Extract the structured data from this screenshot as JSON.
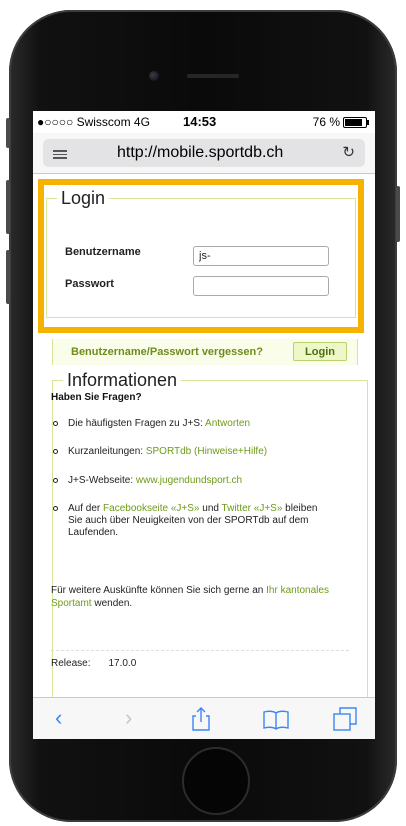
{
  "status": {
    "carrier": "●○○○○ Swisscom  4G",
    "time": "14:53",
    "battery": "76 %"
  },
  "browser": {
    "url": "http://mobile.sportdb.ch"
  },
  "login": {
    "legend": "Login",
    "username_label": "Benutzername",
    "username_value": "js-",
    "password_label": "Passwort",
    "password_value": "",
    "forgot_link": "Benutzername/Passwort vergessen?",
    "login_button": "Login"
  },
  "info": {
    "legend": "Informationen",
    "question": "Haben Sie Fragen?",
    "item1_text": "Die häufigsten Fragen zu J+S: ",
    "item1_link": "Antworten",
    "item2_text": "Kurzanleitungen: ",
    "item2_link": "SPORTdb (Hinweise+Hilfe)",
    "item3_text": "J+S-Webseite: ",
    "item3_link": "www.jugendundsport.ch",
    "item4_a": "Auf der ",
    "item4_link1": "Facebookseite «J+S»",
    "item4_b": " und ",
    "item4_link2": "Twitter «J+S»",
    "item4_c": " bleiben Sie auch über Neuigkeiten von der SPORTdb auf dem Laufenden.",
    "contact_a": "Für weitere Auskünfte können Sie sich gerne an ",
    "contact_link": "Ihr kantonales Sportamt",
    "contact_b": " wenden.",
    "release_label": "Release:",
    "release_value": "17.0.0"
  },
  "toolbar": {
    "back_icon": "chevron-left-icon",
    "forward_icon": "chevron-right-icon",
    "share_icon": "share-icon",
    "bookmarks_icon": "book-icon",
    "tabs_icon": "tabs-icon"
  },
  "colors": {
    "highlight": "#f5b200",
    "link": "#6e9a1a",
    "accent_ios": "#3b86f4"
  }
}
